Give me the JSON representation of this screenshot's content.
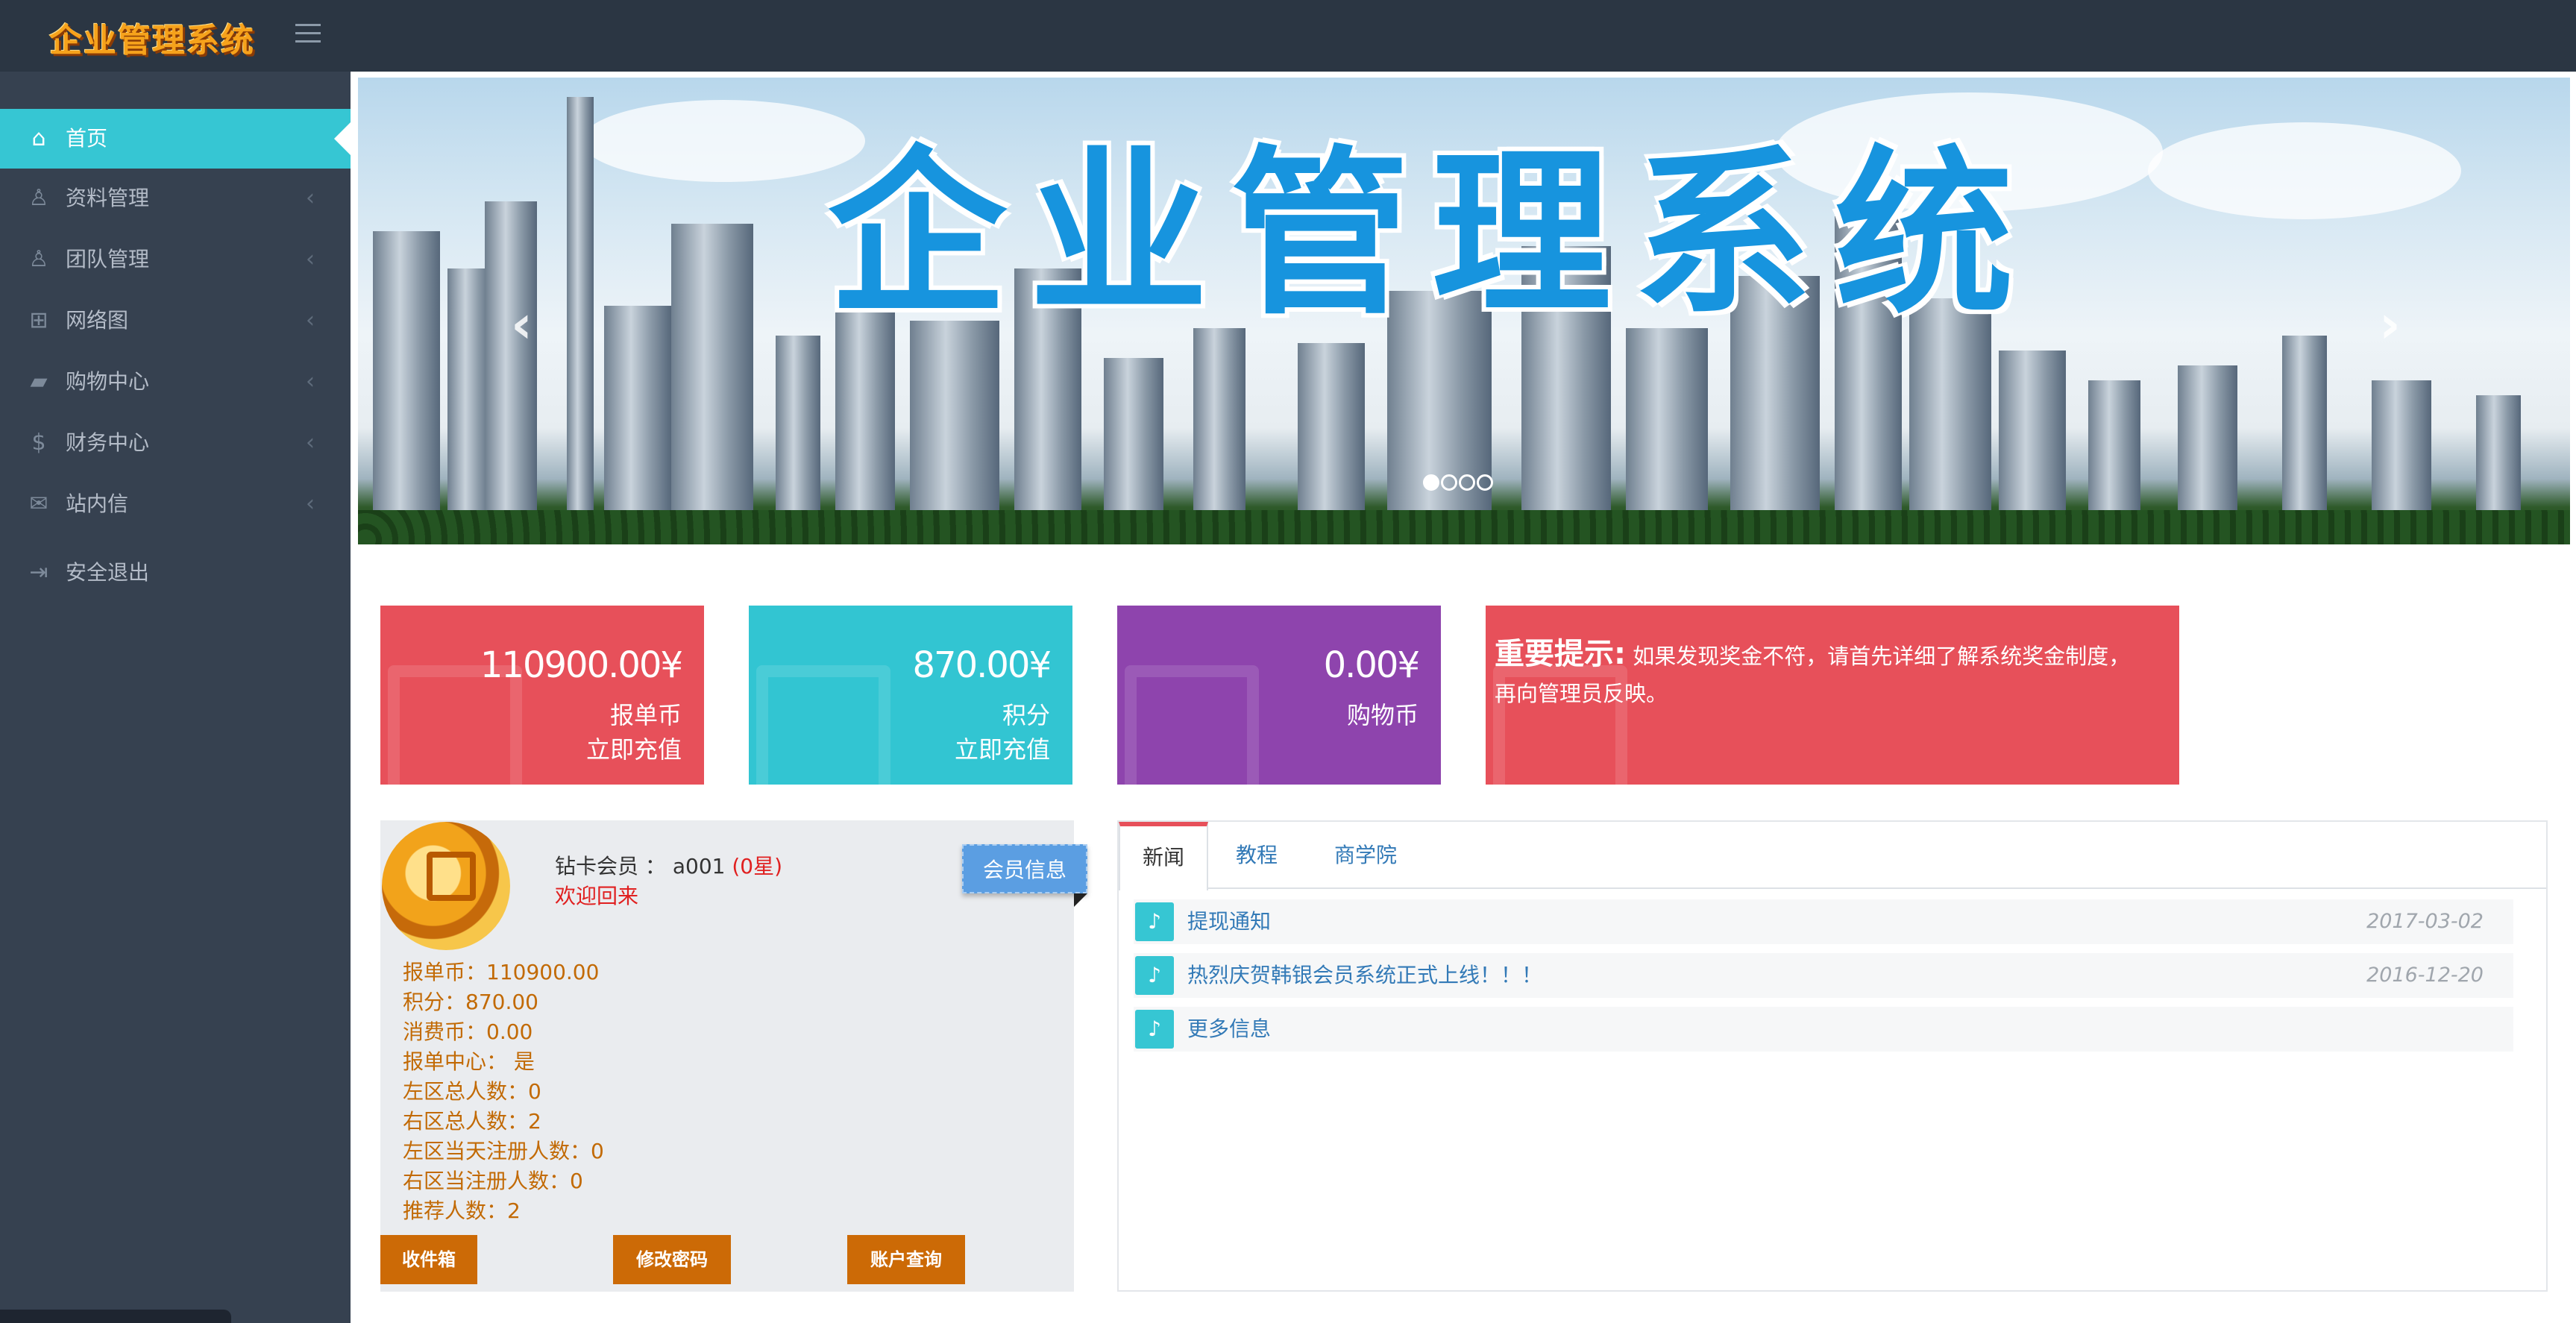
{
  "app": {
    "logo_text": "企业管理系统"
  },
  "sidebar": {
    "items": [
      {
        "label": "首页",
        "icon": "home-icon"
      },
      {
        "label": "资料管理",
        "icon": "user-icon"
      },
      {
        "label": "团队管理",
        "icon": "users-icon"
      },
      {
        "label": "网络图",
        "icon": "sitemap-icon"
      },
      {
        "label": "购物中心",
        "icon": "truck-icon"
      },
      {
        "label": "财务中心",
        "icon": "dollar-icon"
      },
      {
        "label": "站内信",
        "icon": "envelope-icon"
      },
      {
        "label": "安全退出",
        "icon": "logout-icon"
      }
    ]
  },
  "banner": {
    "title": "企业管理系统",
    "slides_total": 4,
    "slide_active": 1
  },
  "cards": [
    {
      "value": "110900.00¥",
      "label": "报单币",
      "action": "立即充值",
      "color": "#e7505a"
    },
    {
      "value": "870.00¥",
      "label": "积分",
      "action": "立即充值",
      "color": "#32c5d2"
    },
    {
      "value": "0.00¥",
      "label": "购物币",
      "color": "#8e44ad"
    }
  ],
  "notice": {
    "title": "重要提示:",
    "line1": "如果发现奖金不符，请首先详细了解系统奖金制度，",
    "line2": "再向管理员反映。",
    "color": "#e7505a"
  },
  "member": {
    "level": "钻卡会员",
    "sep": "：",
    "username": "a001",
    "stars": "(0星)",
    "welcome": "欢迎回来",
    "tag": "会员信息",
    "stats": [
      "报单币：110900.00",
      "积分：870.00",
      "消费币：0.00",
      "报单中心：  是",
      "左区总人数：0",
      "右区总人数：2",
      "左区当天注册人数：0",
      "右区当注册人数：0",
      "推荐人数：2"
    ],
    "buttons": {
      "inbox": "收件箱",
      "change_password": "修改密码",
      "account_query": "账户查询"
    }
  },
  "news": {
    "tabs": [
      "新闻",
      "教程",
      "商学院"
    ],
    "items": [
      {
        "title": "提现通知",
        "date": "2017-03-02"
      },
      {
        "title": "热烈庆贺韩银会员系统正式上线！！！",
        "date": "2016-12-20"
      },
      {
        "title": "更多信息",
        "date": ""
      }
    ]
  }
}
